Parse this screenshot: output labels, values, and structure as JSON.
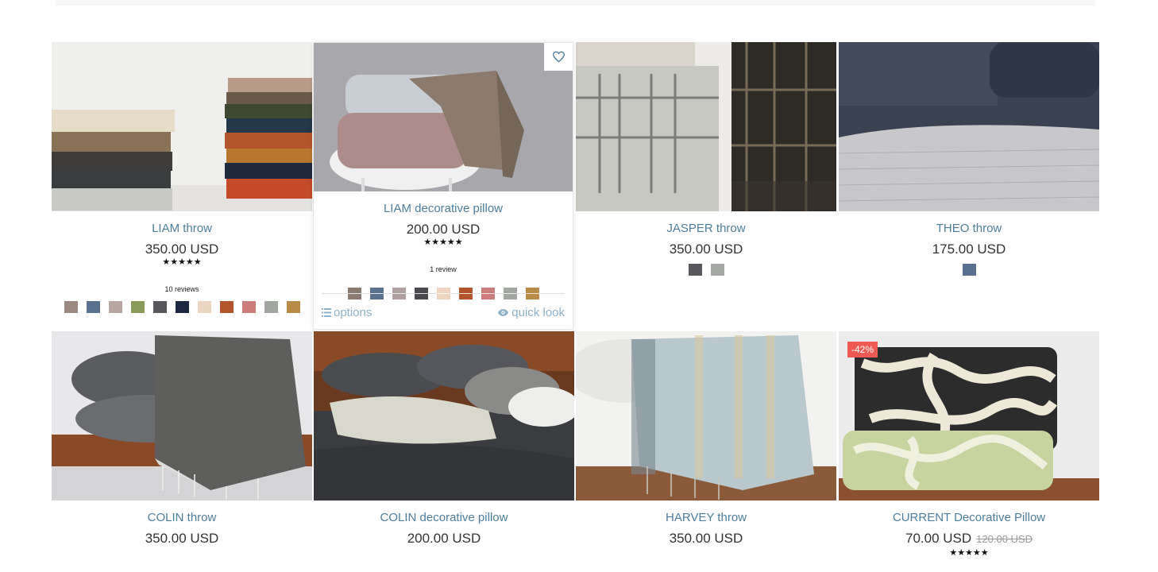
{
  "products": [
    {
      "title": "LIAM throw",
      "price": "350.00 USD",
      "stars": "★★★★★",
      "reviews": "10 reviews",
      "swatches": [
        "#9a8a82",
        "#5a7290",
        "#b8a6a2",
        "#8a9a58",
        "#58585c",
        "#1c2640",
        "#ecd6c2",
        "#b4542c",
        "#cc7c7a",
        "#a2a6a0",
        "#b88c48"
      ]
    },
    {
      "title": "LIAM decorative pillow",
      "price": "200.00 USD",
      "stars": "★★★★★",
      "reviews": "1 review",
      "swatches": [
        "#8a7a72",
        "#5a7290",
        "#b0a0a0",
        "#4a4a4e",
        "#f0d4c0",
        "#b4542c",
        "#cc7c7a",
        "#a2a6a0",
        "#b88c48"
      ],
      "options_label": "options",
      "quick_look_label": "quick look"
    },
    {
      "title": "JASPER throw",
      "price": "350.00 USD",
      "swatches": [
        "#58585c",
        "#a5a8a4"
      ]
    },
    {
      "title": "THEO throw",
      "price": "175.00 USD",
      "swatches": [
        "#5a7090"
      ]
    },
    {
      "title": "COLIN throw",
      "price": "350.00 USD"
    },
    {
      "title": "COLIN decorative pillow",
      "price": "200.00 USD"
    },
    {
      "title": "HARVEY throw",
      "price": "350.00 USD"
    },
    {
      "title": "CURRENT Decorative Pillow",
      "price": "70.00 USD",
      "old_price": "120.00 USD",
      "stars": "★★★★★",
      "badge": "-42%"
    }
  ],
  "icons": {
    "wishlist": "heart-icon",
    "options": "list-icon",
    "quick_look": "eye-icon"
  }
}
